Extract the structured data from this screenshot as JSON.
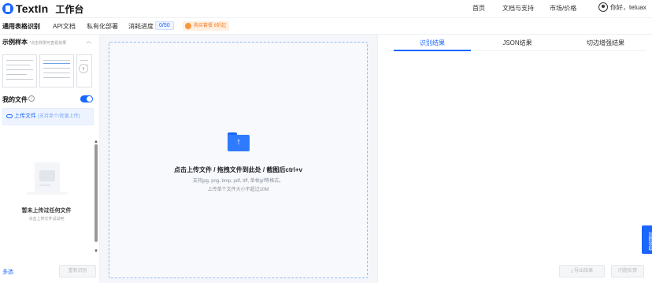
{
  "header": {
    "logo_text": "TextIn",
    "app_title": "工作台",
    "nav": [
      "首页",
      "文档与支持",
      "市场/价格"
    ],
    "user_greeting": "你好，tetuax"
  },
  "subbar": {
    "title": "通用表格识别",
    "links": [
      "API文档",
      "私有化部署"
    ],
    "progress_label": "消耗进度",
    "progress_value": "0/50",
    "promo": "购买套餐 8折起"
  },
  "left": {
    "sample_title": "示例样本",
    "sample_hint": "*点击样例可查看效果",
    "myfiles_title": "我的文件",
    "upload_label": "上传文件",
    "upload_hint": "(支持单个/批量上传)",
    "empty_title": "暂未上传过任何文件",
    "empty_sub": "点击上传文件试试吧",
    "multi_select": "多选",
    "rerecognize": "重新识别"
  },
  "middle": {
    "title": "点击上传文件 / 拖拽文件到此处 / 截图后ctrl+v",
    "sub1": "支持jpg, png, bmp, pdf, tiff, 单帧gif等格式。",
    "sub2": "上传单个文件大小不超过10M"
  },
  "right": {
    "tabs": [
      "识别结果",
      "JSON结果",
      "切边增强结果"
    ],
    "export": "导出结果",
    "feedback": "问题反馈"
  },
  "float_tab": "加群领取",
  "colors": {
    "accent": "#1a66ff",
    "promo": "#f37a21"
  }
}
